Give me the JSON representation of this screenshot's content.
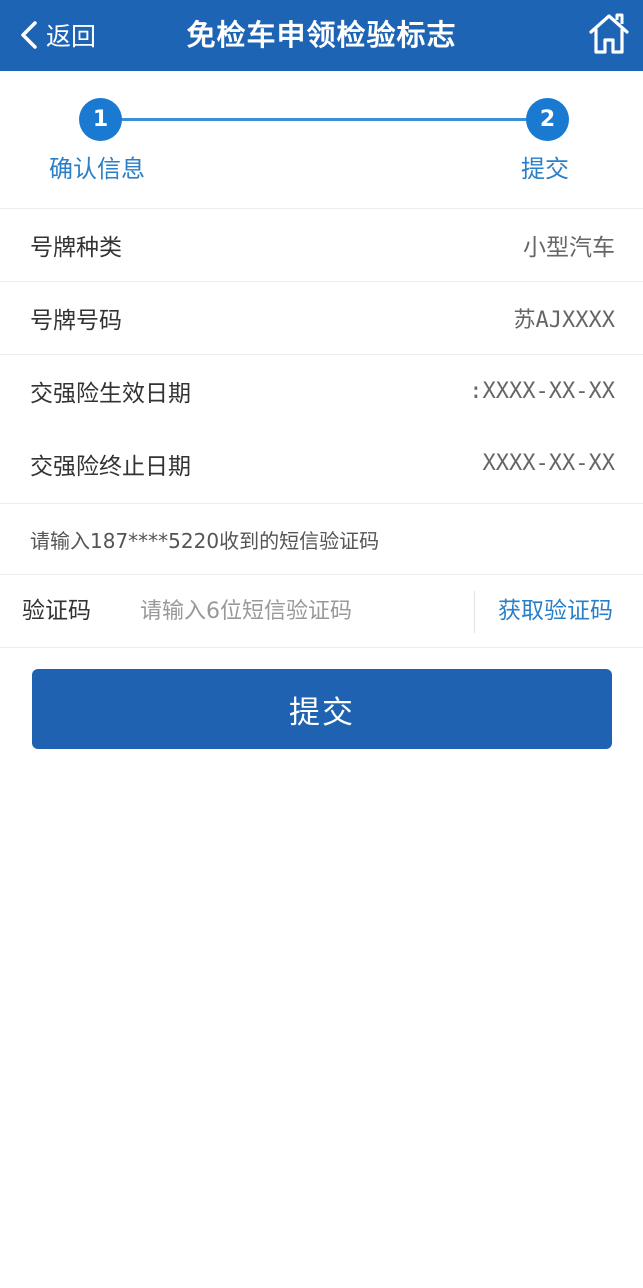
{
  "header": {
    "back_label": "返回",
    "title": "免检车申领检验标志",
    "home_icon": "home-icon",
    "bg_color": "#1e64b4"
  },
  "steps": [
    {
      "number": "1",
      "label": "确认信息"
    },
    {
      "number": "2",
      "label": "提交"
    }
  ],
  "info": {
    "plate_type": {
      "label": "号牌种类",
      "value": "小型汽车"
    },
    "plate_number": {
      "label": "号牌号码",
      "value": "苏AJXXXX"
    },
    "insurance_start": {
      "label": "交强险生效日期",
      "value": ":XXXX-XX-XX"
    },
    "insurance_end": {
      "label": "交强险终止日期",
      "value": "XXXX-XX-XX"
    }
  },
  "sms": {
    "tip": "请输入187****5220收到的短信验证码",
    "code_label": "验证码",
    "code_placeholder": "请输入6位短信验证码",
    "code_value": "",
    "get_code_label": "获取验证码"
  },
  "submit_label": "提交",
  "colors": {
    "accent": "#1a7ad1",
    "link": "#2a7fc9",
    "button": "#1f62b2"
  }
}
